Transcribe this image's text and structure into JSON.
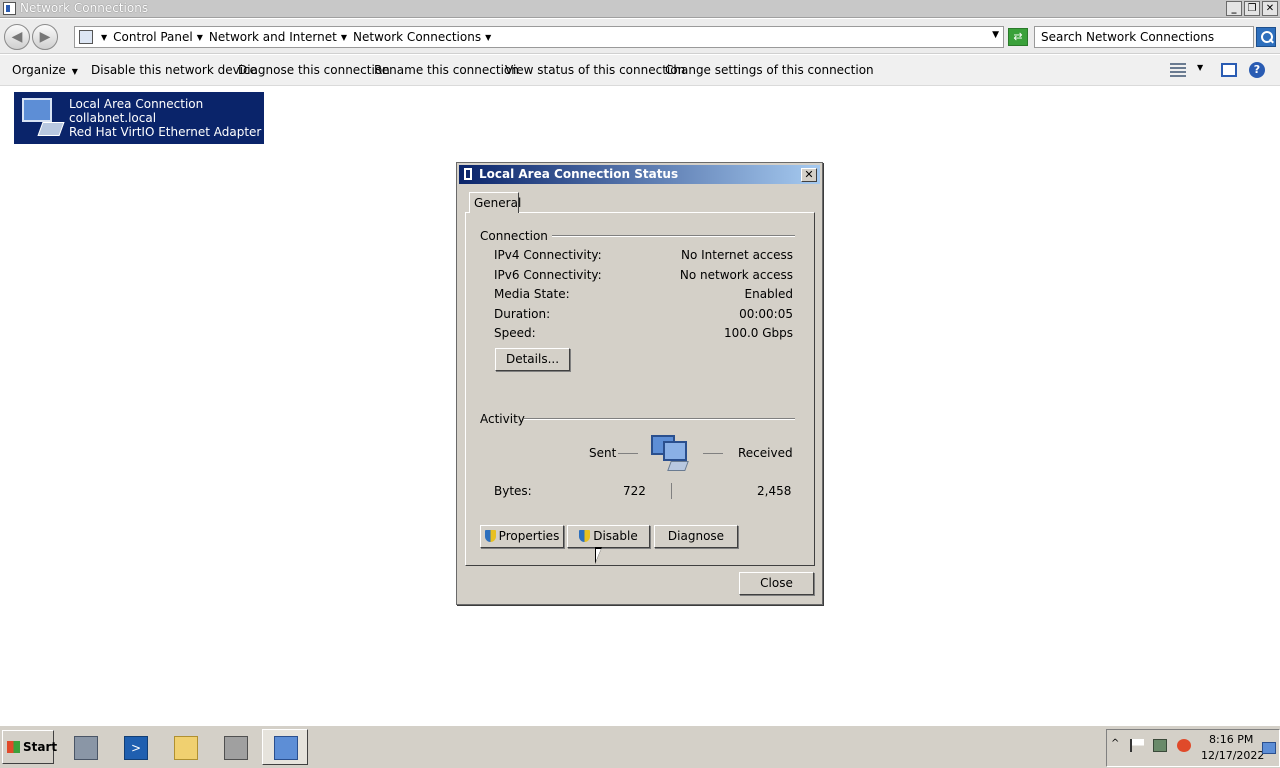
{
  "window": {
    "title": "Network Connections"
  },
  "address": {
    "crumbs": [
      "Control Panel",
      "Network and Internet",
      "Network Connections"
    ],
    "search_placeholder": "Search Network Connections"
  },
  "commands": {
    "organize": "Organize",
    "disable_device": "Disable this network device",
    "diagnose": "Diagnose this connection",
    "rename": "Rename this connection",
    "view_status": "View status of this connection",
    "change_settings": "Change settings of this connection"
  },
  "connection": {
    "name": "Local Area Connection",
    "network": "collabnet.local",
    "adapter": "Red Hat VirtIO Ethernet Adapter"
  },
  "dialog": {
    "title": "Local Area Connection Status",
    "tab": "General",
    "connection_group": "Connection",
    "rows": [
      {
        "label": "IPv4 Connectivity:",
        "value": "No Internet access"
      },
      {
        "label": "IPv6 Connectivity:",
        "value": "No network access"
      },
      {
        "label": "Media State:",
        "value": "Enabled"
      },
      {
        "label": "Duration:",
        "value": "00:00:05"
      },
      {
        "label": "Speed:",
        "value": "100.0 Gbps"
      }
    ],
    "details_button": "Details...",
    "activity_group": "Activity",
    "sent_label": "Sent",
    "received_label": "Received",
    "bytes_label": "Bytes:",
    "bytes_sent": "722",
    "bytes_received": "2,458",
    "properties_button": "Properties",
    "disable_button": "Disable",
    "diagnose_button": "Diagnose",
    "close_button": "Close"
  },
  "taskbar": {
    "start_label": "Start",
    "time": "8:16 PM",
    "date": "12/17/2022"
  }
}
